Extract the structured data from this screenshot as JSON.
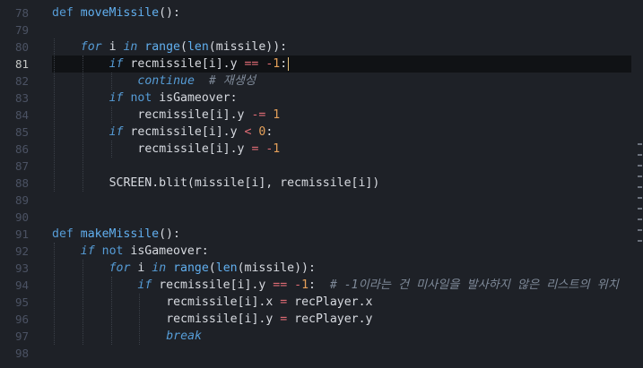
{
  "editor": {
    "active_line": 81,
    "lines": [
      {
        "n": 78,
        "indent": 0,
        "tokens": [
          [
            "def",
            "def "
          ],
          [
            "fn",
            "moveMissile"
          ],
          [
            "txt",
            "():"
          ]
        ]
      },
      {
        "n": 79,
        "indent": 0,
        "tokens": []
      },
      {
        "n": 80,
        "indent": 1,
        "tokens": [
          [
            "kwi",
            "for"
          ],
          [
            "txt",
            " i "
          ],
          [
            "kwi",
            "in"
          ],
          [
            "txt",
            " "
          ],
          [
            "builtin",
            "range"
          ],
          [
            "txt",
            "("
          ],
          [
            "builtin",
            "len"
          ],
          [
            "txt",
            "(missile)):"
          ]
        ]
      },
      {
        "n": 81,
        "indent": 2,
        "tokens": [
          [
            "kwi",
            "if"
          ],
          [
            "txt",
            " recmissile[i].y "
          ],
          [
            "op",
            "=="
          ],
          [
            "txt",
            " "
          ],
          [
            "op",
            "-"
          ],
          [
            "num",
            "1"
          ],
          [
            "txt",
            ":"
          ]
        ],
        "cursor": true
      },
      {
        "n": 82,
        "indent": 3,
        "tokens": [
          [
            "ctrl",
            "continue"
          ],
          [
            "txt",
            "  "
          ],
          [
            "cm",
            "# 재생성"
          ]
        ]
      },
      {
        "n": 83,
        "indent": 2,
        "tokens": [
          [
            "kwi",
            "if"
          ],
          [
            "txt",
            " "
          ],
          [
            "kw",
            "not"
          ],
          [
            "txt",
            " isGameover:"
          ]
        ]
      },
      {
        "n": 84,
        "indent": 3,
        "tokens": [
          [
            "txt",
            "recmissile[i].y "
          ],
          [
            "op",
            "-="
          ],
          [
            "txt",
            " "
          ],
          [
            "num",
            "1"
          ]
        ]
      },
      {
        "n": 85,
        "indent": 2,
        "tokens": [
          [
            "kwi",
            "if"
          ],
          [
            "txt",
            " recmissile[i].y "
          ],
          [
            "op",
            "<"
          ],
          [
            "txt",
            " "
          ],
          [
            "num",
            "0"
          ],
          [
            "txt",
            ":"
          ]
        ]
      },
      {
        "n": 86,
        "indent": 3,
        "tokens": [
          [
            "txt",
            "recmissile[i].y "
          ],
          [
            "op",
            "="
          ],
          [
            "txt",
            " "
          ],
          [
            "op",
            "-"
          ],
          [
            "num",
            "1"
          ]
        ]
      },
      {
        "n": 87,
        "indent": 0,
        "tokens": []
      },
      {
        "n": 88,
        "indent": 2,
        "tokens": [
          [
            "txt",
            "SCREEN.blit(missile[i], recmissile[i])"
          ]
        ]
      },
      {
        "n": 89,
        "indent": 0,
        "tokens": []
      },
      {
        "n": 90,
        "indent": 0,
        "tokens": []
      },
      {
        "n": 91,
        "indent": 0,
        "tokens": [
          [
            "def",
            "def "
          ],
          [
            "fn",
            "makeMissile"
          ],
          [
            "txt",
            "():"
          ]
        ]
      },
      {
        "n": 92,
        "indent": 1,
        "tokens": [
          [
            "kwi",
            "if"
          ],
          [
            "txt",
            " "
          ],
          [
            "kw",
            "not"
          ],
          [
            "txt",
            " isGameover:"
          ]
        ]
      },
      {
        "n": 93,
        "indent": 2,
        "tokens": [
          [
            "kwi",
            "for"
          ],
          [
            "txt",
            " i "
          ],
          [
            "kwi",
            "in"
          ],
          [
            "txt",
            " "
          ],
          [
            "builtin",
            "range"
          ],
          [
            "txt",
            "("
          ],
          [
            "builtin",
            "len"
          ],
          [
            "txt",
            "(missile)):"
          ]
        ]
      },
      {
        "n": 94,
        "indent": 3,
        "tokens": [
          [
            "kwi",
            "if"
          ],
          [
            "txt",
            " recmissile[i].y "
          ],
          [
            "op",
            "=="
          ],
          [
            "txt",
            " "
          ],
          [
            "op",
            "-"
          ],
          [
            "num",
            "1"
          ],
          [
            "txt",
            ":  "
          ],
          [
            "cm",
            "# -1이라는 건 미사일을 발사하지 않은 리스트의 위치"
          ]
        ]
      },
      {
        "n": 95,
        "indent": 4,
        "tokens": [
          [
            "txt",
            "recmissile[i].x "
          ],
          [
            "op",
            "="
          ],
          [
            "txt",
            " recPlayer.x"
          ]
        ]
      },
      {
        "n": 96,
        "indent": 4,
        "tokens": [
          [
            "txt",
            "recmissile[i].y "
          ],
          [
            "op",
            "="
          ],
          [
            "txt",
            " recPlayer.y"
          ]
        ]
      },
      {
        "n": 97,
        "indent": 4,
        "tokens": [
          [
            "ctrl",
            "break"
          ]
        ]
      },
      {
        "n": 98,
        "indent": 0,
        "tokens": []
      }
    ]
  },
  "colors": {
    "background": "#1e2127",
    "keyword": "#569cd6",
    "function": "#61afef",
    "number": "#e5a05a",
    "operator": "#e06c75",
    "comment": "#7f8a99",
    "text": "#d7dae0"
  }
}
